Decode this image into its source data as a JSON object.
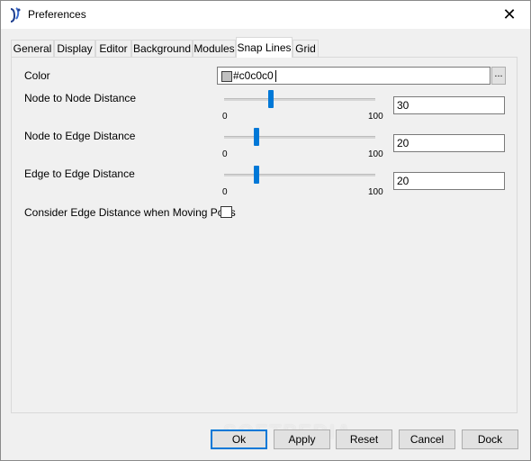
{
  "window": {
    "title": "Preferences",
    "close_glyph": "✕"
  },
  "tabs": [
    {
      "label": "General",
      "active": false
    },
    {
      "label": "Display",
      "active": false
    },
    {
      "label": "Editor",
      "active": false
    },
    {
      "label": "Background",
      "active": false
    },
    {
      "label": "Modules",
      "active": false
    },
    {
      "label": "Snap Lines",
      "active": true
    },
    {
      "label": "Grid",
      "active": false
    }
  ],
  "snap_lines": {
    "color_label": "Color",
    "color_value": "#c0c0c0",
    "color_swatch": "#c0c0c0",
    "browse_label": "...",
    "node_to_node": {
      "label": "Node to Node Distance",
      "value": "30",
      "slider_value": 30,
      "min": "0",
      "max": "100"
    },
    "node_to_edge": {
      "label": "Node to Edge Distance",
      "value": "20",
      "slider_value": 20,
      "min": "0",
      "max": "100"
    },
    "edge_to_edge": {
      "label": "Edge to Edge Distance",
      "value": "20",
      "slider_value": 20,
      "min": "0",
      "max": "100"
    },
    "moving_ports": {
      "label": "Consider Edge Distance when Moving Ports",
      "checked": false
    }
  },
  "buttons": {
    "ok": "Ok",
    "apply": "Apply",
    "reset": "Reset",
    "cancel": "Cancel",
    "dock": "Dock"
  },
  "watermark": "SOFTPEDIA",
  "colors": {
    "accent": "#0078d7",
    "window_bg": "#f0f0f0"
  }
}
